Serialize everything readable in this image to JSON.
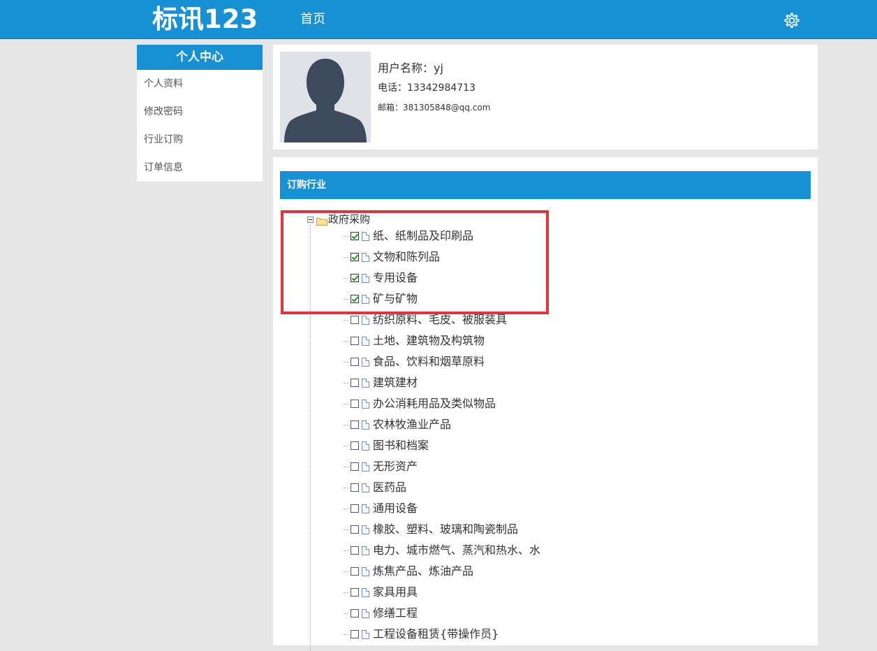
{
  "header": {
    "logo": "标讯123",
    "nav_home": "首页",
    "settings_icon": "gear-icon"
  },
  "sidebar": {
    "title": "个人中心",
    "items": [
      {
        "label": "个人资料"
      },
      {
        "label": "修改密码"
      },
      {
        "label": "行业订购"
      },
      {
        "label": "订单信息"
      }
    ]
  },
  "profile": {
    "name": "用户名称：yj",
    "phone": "电话：13342984713",
    "email": "邮箱：381305848@qq.com"
  },
  "subscription": {
    "header": "订购行业",
    "root_label": "政府采购",
    "items": [
      {
        "label": "纸、纸制品及印刷品",
        "checked": true
      },
      {
        "label": "文物和陈列品",
        "checked": true
      },
      {
        "label": "专用设备",
        "checked": true
      },
      {
        "label": "矿与矿物",
        "checked": true
      },
      {
        "label": "纺织原料、毛皮、被服装具",
        "checked": false
      },
      {
        "label": "土地、建筑物及构筑物",
        "checked": false
      },
      {
        "label": "食品、饮料和烟草原料",
        "checked": false
      },
      {
        "label": "建筑建材",
        "checked": false
      },
      {
        "label": "办公消耗用品及类似物品",
        "checked": false
      },
      {
        "label": "农林牧渔业产品",
        "checked": false
      },
      {
        "label": "图书和档案",
        "checked": false
      },
      {
        "label": "无形资产",
        "checked": false
      },
      {
        "label": "医药品",
        "checked": false
      },
      {
        "label": "通用设备",
        "checked": false
      },
      {
        "label": "橡胶、塑料、玻璃和陶瓷制品",
        "checked": false
      },
      {
        "label": "电力、城市燃气、蒸汽和热水、水",
        "checked": false
      },
      {
        "label": "炼焦产品、炼油产品",
        "checked": false
      },
      {
        "label": "家具用具",
        "checked": false
      },
      {
        "label": "修缮工程",
        "checked": false
      },
      {
        "label": "工程设备租赁{带操作员}",
        "checked": false
      }
    ]
  },
  "colors": {
    "brand_blue": "#1891d4",
    "highlight_red": "#e8323a",
    "check_green": "#1a9a1a"
  }
}
